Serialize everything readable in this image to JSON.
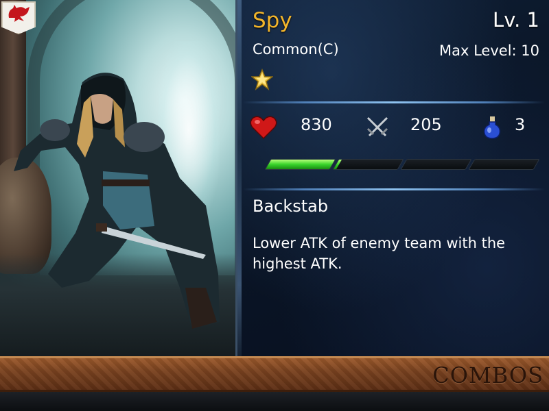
{
  "card": {
    "name": "Spy",
    "level": "Lv. 1",
    "rarity": "Common(C)",
    "max_level": "Max Level: 10",
    "stars": 1,
    "hp": "830",
    "attack": "205",
    "potion": "3",
    "xp_progress": 0.26
  },
  "skill": {
    "name": "Backstab",
    "description": "Lower ATK of enemy team with the highest ATK."
  },
  "footer": {
    "combos_label": "COMBOS"
  },
  "colors": {
    "name_gold": "#f2b52b",
    "xp_green": "#38d42a"
  },
  "icons": {
    "faction": "red-dragon-crest-icon",
    "star": "gold-star-icon",
    "hp": "heart-icon",
    "attack": "crossed-swords-icon",
    "potion": "mana-potion-icon"
  }
}
